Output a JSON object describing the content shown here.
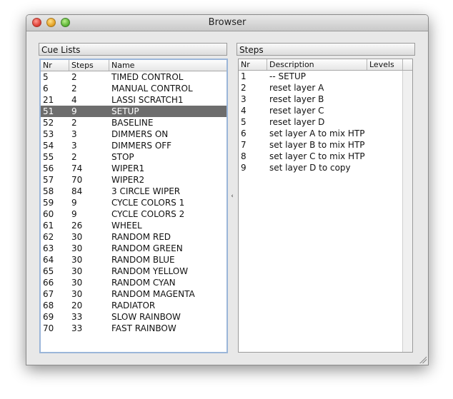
{
  "window": {
    "title": "Browser"
  },
  "cue_lists": {
    "header": "Cue Lists",
    "columns": [
      "Nr",
      "Steps",
      "Name"
    ],
    "selected_index": 3,
    "rows": [
      [
        "5",
        "2",
        "TIMED CONTROL"
      ],
      [
        "6",
        "2",
        "MANUAL CONTROL"
      ],
      [
        "21",
        "4",
        "LASSI SCRATCH1"
      ],
      [
        "51",
        "9",
        "SETUP"
      ],
      [
        "52",
        "2",
        "BASELINE"
      ],
      [
        "53",
        "3",
        "DIMMERS ON"
      ],
      [
        "54",
        "3",
        "DIMMERS OFF"
      ],
      [
        "55",
        "2",
        "STOP"
      ],
      [
        "56",
        "74",
        "WIPER1"
      ],
      [
        "57",
        "70",
        "WIPER2"
      ],
      [
        "58",
        "84",
        "3 CIRCLE WIPER"
      ],
      [
        "59",
        "9",
        "CYCLE COLORS 1"
      ],
      [
        "60",
        "9",
        "CYCLE COLORS 2"
      ],
      [
        "61",
        "26",
        "WHEEL"
      ],
      [
        "62",
        "30",
        "RANDOM RED"
      ],
      [
        "63",
        "30",
        "RANDOM GREEN"
      ],
      [
        "64",
        "30",
        "RANDOM BLUE"
      ],
      [
        "65",
        "30",
        "RANDOM YELLOW"
      ],
      [
        "66",
        "30",
        "RANDOM CYAN"
      ],
      [
        "67",
        "30",
        "RANDOM MAGENTA"
      ],
      [
        "68",
        "20",
        "RADIATOR"
      ],
      [
        "69",
        "33",
        "SLOW RAINBOW"
      ],
      [
        "70",
        "33",
        "FAST RAINBOW"
      ]
    ]
  },
  "steps": {
    "header": "Steps",
    "columns": [
      "Nr",
      "Description",
      "Levels"
    ],
    "rows": [
      [
        "1",
        "-- SETUP",
        ""
      ],
      [
        "2",
        "reset layer A",
        ""
      ],
      [
        "3",
        "reset layer B",
        ""
      ],
      [
        "4",
        "reset layer C",
        ""
      ],
      [
        "5",
        "reset layer D",
        ""
      ],
      [
        "6",
        "set layer A to mix HTP",
        ""
      ],
      [
        "7",
        "set layer B to mix HTP",
        ""
      ],
      [
        "8",
        "set layer C to mix HTP",
        ""
      ],
      [
        "9",
        "set layer D to copy",
        ""
      ]
    ]
  },
  "splitter": {
    "arrow": "‹"
  }
}
